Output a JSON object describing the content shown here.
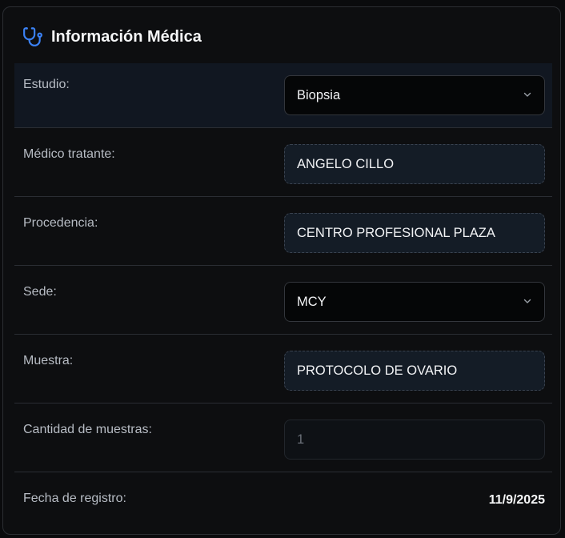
{
  "header": {
    "title": "Información Médica",
    "icon": "stethoscope-icon",
    "accent": "#3b82f6"
  },
  "fields": {
    "estudio": {
      "label": "Estudio:",
      "value": "Biopsia"
    },
    "medico": {
      "label": "Médico tratante:",
      "value": "ANGELO CILLO"
    },
    "procedencia": {
      "label": "Procedencia:",
      "value": "CENTRO PROFESIONAL PLAZA"
    },
    "sede": {
      "label": "Sede:",
      "value": "MCY"
    },
    "muestra": {
      "label": "Muestra:",
      "value": "PROTOCOLO DE OVARIO"
    },
    "cantidad": {
      "label": "Cantidad de muestras:",
      "value": "1"
    },
    "fecha": {
      "label": "Fecha de registro:",
      "value": "11/9/2025"
    }
  }
}
